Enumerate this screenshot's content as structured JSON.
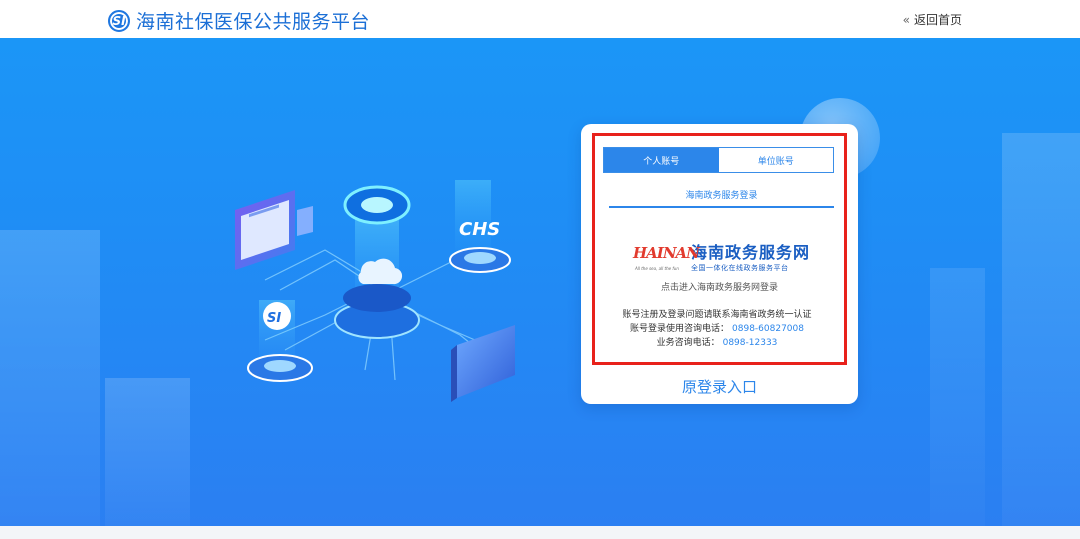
{
  "header": {
    "logo_mark": "SI",
    "site_title": "海南社保医保公共服务平台",
    "back_home": "返回首页",
    "back_icon": "«"
  },
  "login": {
    "tabs": [
      {
        "label": "个人账号",
        "active": true
      },
      {
        "label": "单位账号",
        "active": false
      }
    ],
    "sub_tab": "海南政务服务登录",
    "portal": {
      "logo_word": "HAINAN",
      "logo_tagline": "All the sea, all the fun",
      "name": "海南政务服务网",
      "slogan": "全国一体化在线政务服务平台"
    },
    "enter_hint": "点击进入海南政务服务网登录",
    "info": {
      "line1": "账号注册及登录问题请联系海南省政务统一认证",
      "line2_label": "账号登录使用咨询电话：",
      "line2_phone": "0898-60827008",
      "line3_label": "业务咨询电话：",
      "line3_phone": "0898-12333"
    },
    "old_login": "原登录入口"
  },
  "illustration": {
    "chs_label": "CHS",
    "si_label": "SI"
  },
  "colors": {
    "brand_blue": "#1b6fd6",
    "accent": "#2c86ea",
    "highlight_red": "#e8211b",
    "hero_bg": "#1f8df5"
  }
}
